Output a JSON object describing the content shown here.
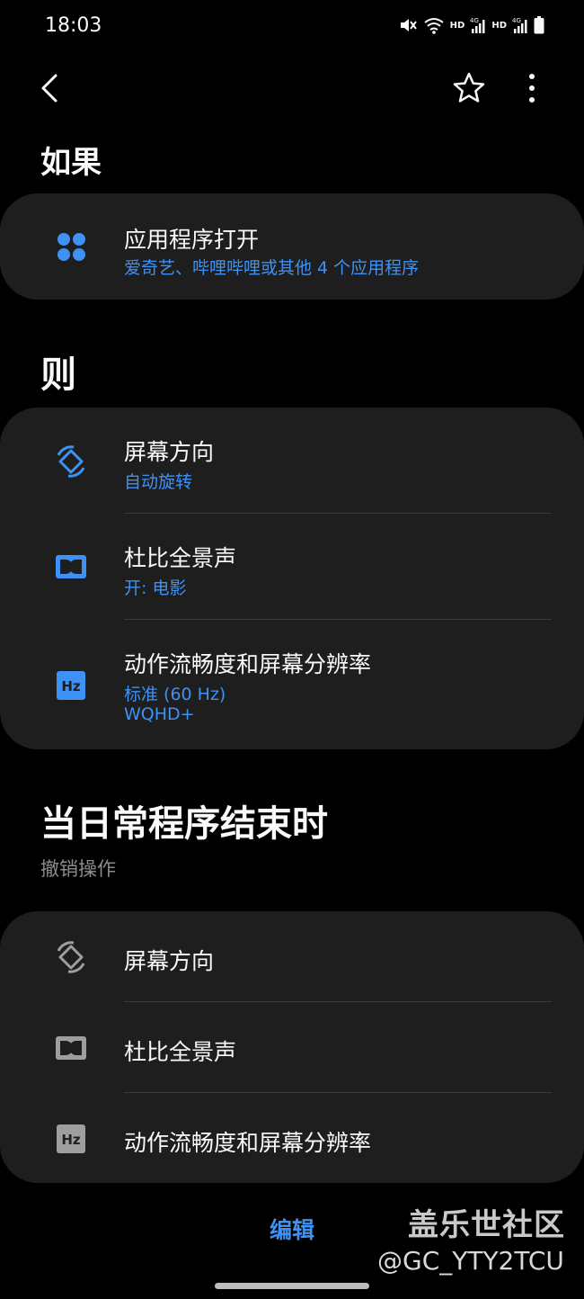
{
  "status_bar": {
    "time": "18:03",
    "hd1": "HD",
    "hd2": "HD",
    "icons": [
      "mute-icon",
      "wifi-icon",
      "signal-4g-icon",
      "signal-4g-icon",
      "battery-icon"
    ]
  },
  "top_bar": {
    "icons": [
      "back-icon",
      "star-icon",
      "more-icon"
    ]
  },
  "if_section": {
    "title": "如果",
    "item": {
      "icon": "apps-icon",
      "title": "应用程序打开",
      "subtitle": "爱奇艺、哔哩哔哩或其他 4 个应用程序"
    }
  },
  "then_section": {
    "title": "则",
    "items": [
      {
        "icon": "rotate-icon",
        "title": "屏幕方向",
        "subtitle": "自动旋转"
      },
      {
        "icon": "dolby-icon",
        "title": "杜比全景声",
        "subtitle": "开: 电影"
      },
      {
        "icon": "hz-icon",
        "title": "动作流畅度和屏幕分辨率",
        "subtitle": "标准 (60 Hz)",
        "subtitle2": "WQHD+"
      }
    ]
  },
  "end_section": {
    "title": "当日常程序结束时",
    "subtitle": "撤销操作",
    "items": [
      {
        "icon": "rotate-icon",
        "title": "屏幕方向"
      },
      {
        "icon": "dolby-icon",
        "title": "杜比全景声"
      },
      {
        "icon": "hz-icon",
        "title": "动作流畅度和屏幕分辨率"
      }
    ]
  },
  "bottom": {
    "edit_label": "编辑",
    "watermark_title": "盖乐世社区",
    "watermark_user": "@GC_YTY2TCU"
  },
  "colors": {
    "background": "#000000",
    "card": "#1e1e1e",
    "accent": "#3e91f5",
    "muted_icon": "#9e9e9e"
  }
}
